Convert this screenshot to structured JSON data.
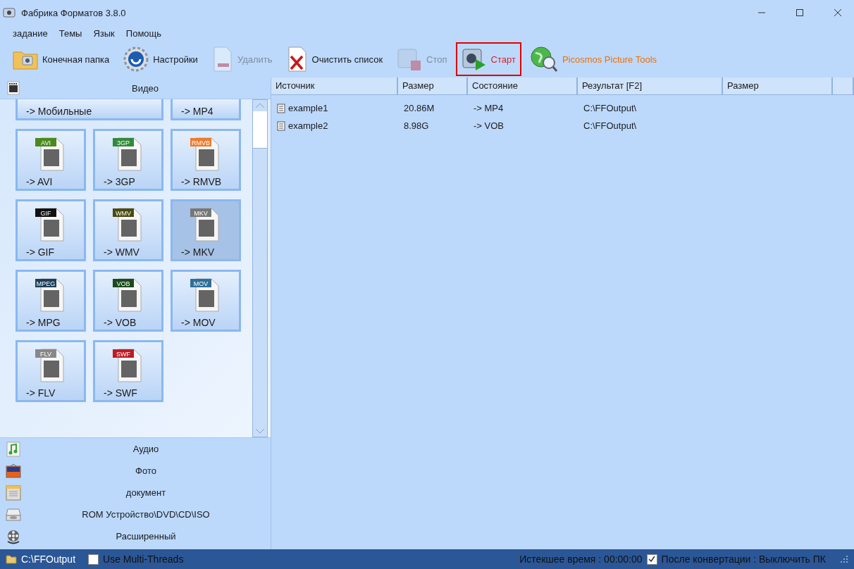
{
  "window": {
    "title": "Фабрика Форматов 3.8.0"
  },
  "menu": [
    "задание",
    "Темы",
    "Язык",
    "Помощь"
  ],
  "toolbar": [
    {
      "label": "Конечная папка",
      "kind": "folder",
      "disabled": false,
      "highlighted": false
    },
    {
      "label": "Настройки",
      "kind": "gear",
      "disabled": false,
      "highlighted": false
    },
    {
      "label": "Удалить",
      "kind": "remove",
      "disabled": true,
      "highlighted": false
    },
    {
      "label": "Очистить список",
      "kind": "clear",
      "disabled": false,
      "highlighted": false
    },
    {
      "label": "Стоп",
      "kind": "stop",
      "disabled": true,
      "highlighted": false
    },
    {
      "label": "Старт",
      "kind": "start",
      "disabled": false,
      "highlighted": true
    },
    {
      "label": "Picosmos Picture Tools",
      "kind": "globe",
      "disabled": false,
      "highlighted": false
    }
  ],
  "sidebar": {
    "open_category": {
      "label": "Видео"
    },
    "tiles": [
      {
        "label": "-> Мобильные",
        "partial": true,
        "wide": true,
        "selected": false
      },
      {
        "label": "-> MP4",
        "partial": true,
        "wide": false,
        "selected": false
      },
      {
        "label": "-> AVI",
        "badge": "AVI",
        "color": "#4a8a1c",
        "selected": false
      },
      {
        "label": "-> 3GP",
        "badge": "3GP",
        "color": "#2f8a3a",
        "selected": false
      },
      {
        "label": "-> RMVB",
        "badge": "RMVB",
        "color": "#f07a2a",
        "selected": false
      },
      {
        "label": "-> GIF",
        "badge": "GIF",
        "color": "#111111",
        "selected": false
      },
      {
        "label": "-> WMV",
        "badge": "WMV",
        "color": "#4a4a10",
        "selected": false
      },
      {
        "label": "-> MKV",
        "badge": "MKV",
        "color": "#777777",
        "selected": true
      },
      {
        "label": "-> MPG",
        "badge": "MPEG",
        "color": "#1c3f5a",
        "selected": false
      },
      {
        "label": "-> VOB",
        "badge": "VOB",
        "color": "#1c4a1c",
        "selected": false
      },
      {
        "label": "-> MOV",
        "badge": "MOV",
        "color": "#2f6f9a",
        "selected": false
      },
      {
        "label": "-> FLV",
        "badge": "FLV",
        "color": "#888888",
        "selected": false
      },
      {
        "label": "-> SWF",
        "badge": "SWF",
        "color": "#c01a24",
        "selected": false
      }
    ],
    "categories": [
      {
        "label": "Аудио",
        "kind": "audio"
      },
      {
        "label": "Фото",
        "kind": "photo"
      },
      {
        "label": "документ",
        "kind": "document"
      },
      {
        "label": "ROM Устройство\\DVD\\CD\\ISO",
        "kind": "disc"
      },
      {
        "label": "Расширенный",
        "kind": "reel"
      }
    ]
  },
  "table": {
    "columns": [
      "Источник",
      "Размер",
      "Состояние",
      "Результат [F2]",
      "Размер"
    ],
    "rows": [
      [
        "example1",
        "20.86M",
        "-> MP4",
        "C:\\FFOutput\\"
      ],
      [
        "example2",
        "8.98G",
        "-> VOB",
        "C:\\FFOutput\\"
      ]
    ]
  },
  "status_bar": {
    "path": "C:\\FFOutput",
    "multi_threads": {
      "label": "Use Multi-Threads",
      "checked": false
    },
    "elapsed": "Истекшее время : 00:00:00",
    "after": {
      "label": "После конвертации : Выключить ПК",
      "checked": true
    }
  }
}
